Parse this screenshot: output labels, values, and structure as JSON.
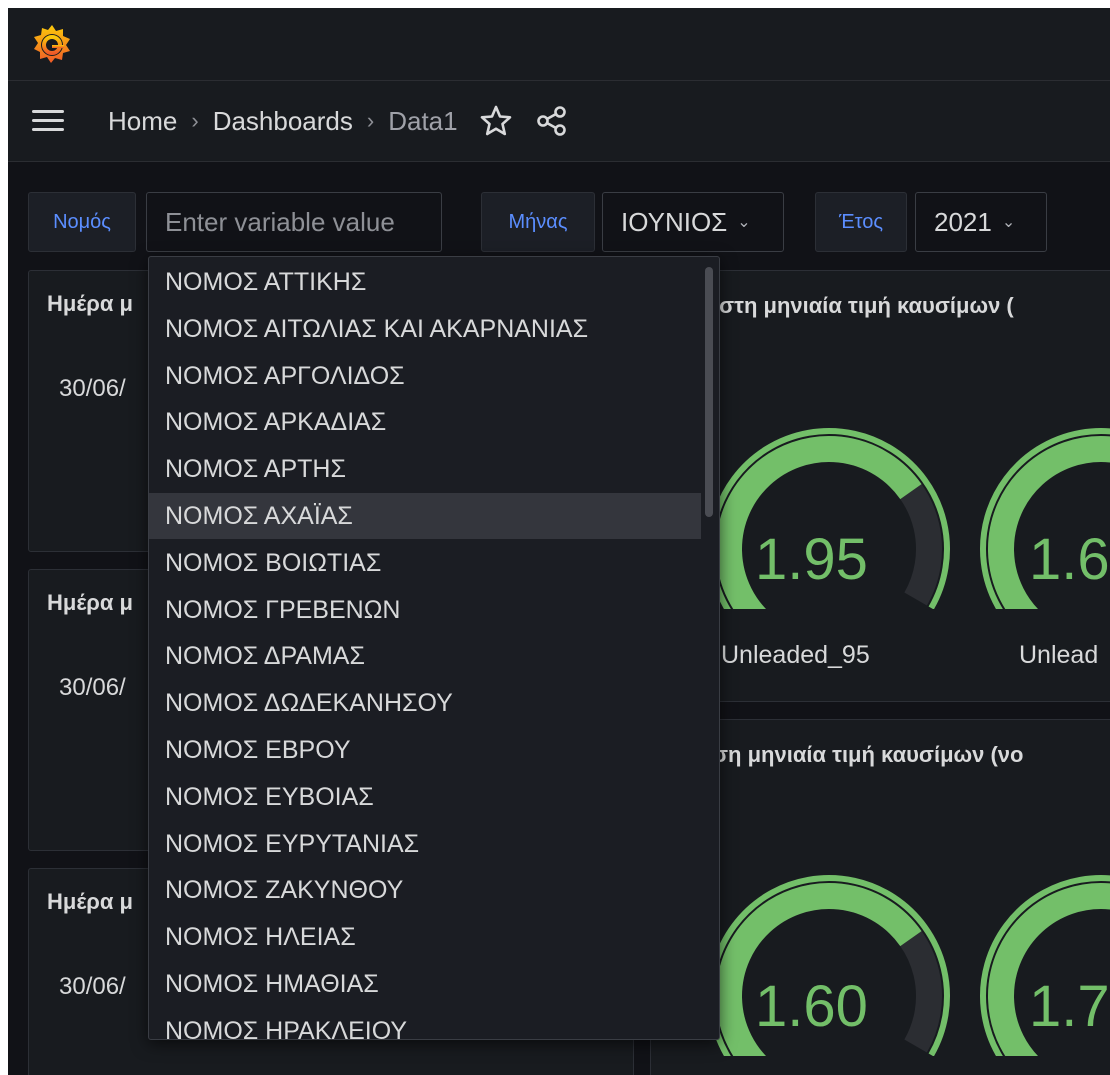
{
  "nav": {
    "logo_icon": "grafana-logo-icon",
    "menu_icon": "hamburger-menu-icon",
    "breadcrumbs": [
      {
        "label": "Home"
      },
      {
        "label": "Dashboards"
      },
      {
        "label": "Data1"
      }
    ],
    "separator": "›",
    "star_icon": "star-icon",
    "share_icon": "share-icon"
  },
  "variables": {
    "nomos": {
      "label": "Νομός",
      "placeholder": "Enter variable value",
      "value": ""
    },
    "minas": {
      "label": "Μήνας",
      "value": "ΙΟΥΝΙΟΣ"
    },
    "etos": {
      "label": "Έτος",
      "value": "2021"
    }
  },
  "panels": {
    "left": [
      {
        "title": "Ημέρα μ",
        "value": "30/06/"
      },
      {
        "title": "Ημέρα μ",
        "value": "30/06/"
      },
      {
        "title": "Ημέρα μ",
        "value": "30/06/"
      }
    ],
    "right": [
      {
        "title": "ιστη μηνιαία τιμή καυσίμων (",
        "gauges": [
          {
            "value": "1.95",
            "label": "Unleaded_95",
            "fill": 0.75
          },
          {
            "value": "1.6",
            "label": "Unlead",
            "fill": 0.75
          }
        ]
      },
      {
        "title": "ση μηνιαία τιμή καυσίμων (νο",
        "gauges": [
          {
            "value": "1.60",
            "label": "",
            "fill": 0.75
          },
          {
            "value": "1.7",
            "label": "",
            "fill": 0.75
          }
        ]
      }
    ]
  },
  "dropdown": {
    "highlighted_index": 5,
    "options": [
      "ΝΟΜΟΣ ΑΤΤΙΚΗΣ",
      "ΝΟΜΟΣ ΑΙΤΩΛΙΑΣ ΚΑΙ ΑΚΑΡΝΑΝΙΑΣ",
      "ΝΟΜΟΣ ΑΡΓΟΛΙΔΟΣ",
      "ΝΟΜΟΣ ΑΡΚΑΔΙΑΣ",
      "ΝΟΜΟΣ ΑΡΤΗΣ",
      "ΝΟΜΟΣ ΑΧΑΪΑΣ",
      "ΝΟΜΟΣ ΒΟΙΩΤΙΑΣ",
      "ΝΟΜΟΣ ΓΡΕΒΕΝΩΝ",
      "ΝΟΜΟΣ ΔΡΑΜΑΣ",
      "ΝΟΜΟΣ ΔΩΔΕΚΑΝΗΣΟΥ",
      "ΝΟΜΟΣ ΕΒΡΟΥ",
      "ΝΟΜΟΣ ΕΥΒΟΙΑΣ",
      "ΝΟΜΟΣ ΕΥΡΥΤΑΝΙΑΣ",
      "ΝΟΜΟΣ ΖΑΚΥΝΘΟΥ",
      "ΝΟΜΟΣ ΗΛΕΙΑΣ",
      "ΝΟΜΟΣ ΗΜΑΘΙΑΣ",
      "ΝΟΜΟΣ ΗΡΑΚΛΕΙΟΥ"
    ]
  },
  "colors": {
    "accent_blue": "#5b8eff",
    "gauge_green": "#73bf69",
    "gauge_track": "#2b2d32",
    "logo_orange": "#f46800"
  }
}
